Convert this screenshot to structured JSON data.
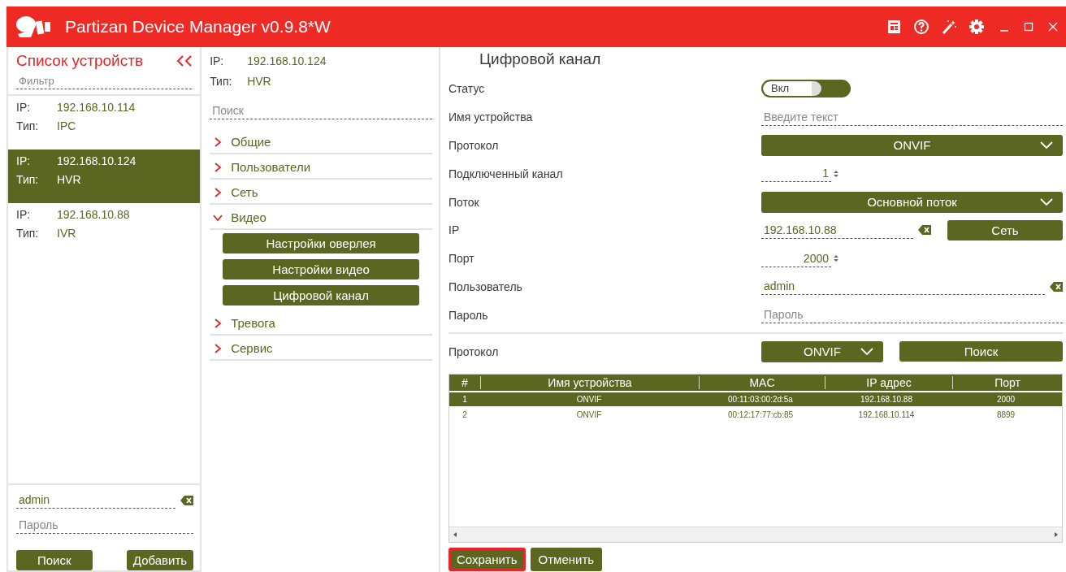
{
  "window": {
    "title": "Partizan Device Manager v0.9.8*W"
  },
  "devices_panel": {
    "title": "Список устройств",
    "filter": {
      "placeholder": "Фильтр"
    },
    "devices": [
      {
        "ip_label": "IP:",
        "ip": "192.168.10.114",
        "type_label": "Тип:",
        "type": "IPC",
        "selected": false
      },
      {
        "ip_label": "IP:",
        "ip": "192.168.10.124",
        "type_label": "Тип:",
        "type": "HVR",
        "selected": true
      },
      {
        "ip_label": "IP:",
        "ip": "192.168.10.88",
        "type_label": "Тип:",
        "type": "IVR",
        "selected": false
      }
    ],
    "login": {
      "user": "admin",
      "password_placeholder": "Пароль"
    },
    "buttons": [
      "Поиск",
      "Добавить"
    ]
  },
  "device_info": {
    "ip_label": "IP:",
    "ip": "192.168.10.124",
    "type_label": "Тип:",
    "type": "HVR"
  },
  "menu_search": {
    "placeholder": "Поиск"
  },
  "menu": [
    {
      "label": "Общие",
      "expanded": false
    },
    {
      "label": "Пользователи",
      "expanded": false
    },
    {
      "label": "Сеть",
      "expanded": false
    },
    {
      "label": "Видео",
      "expanded": true,
      "children": [
        "Настройки оверлея",
        "Настройки видео",
        "Цифровой канал"
      ]
    },
    {
      "label": "Тревога",
      "expanded": false
    },
    {
      "label": "Сервис",
      "expanded": false
    }
  ],
  "channel": {
    "title": "Цифровой канал",
    "fields": [
      {
        "kind": "toggle",
        "label": "Статус",
        "text": "Вкл",
        "on": true
      },
      {
        "kind": "text",
        "label": "Имя устройства",
        "placeholder": "Введите текст",
        "clearable": false
      },
      {
        "kind": "select",
        "label": "Протокол",
        "value": "ONVIF"
      },
      {
        "kind": "spin",
        "label": "Подключенный канал",
        "value": "1"
      },
      {
        "kind": "select",
        "label": "Поток",
        "value": "Основной поток"
      },
      {
        "kind": "text",
        "label": "IP",
        "value": "192.168.10.88",
        "clearable": true,
        "button": "Сеть"
      },
      {
        "kind": "spin",
        "label": "Порт",
        "value": "2000"
      },
      {
        "kind": "text",
        "label": "Пользователь",
        "value": "admin",
        "clearable": true
      },
      {
        "kind": "text",
        "label": "Пароль",
        "placeholder": "Пароль",
        "clearable": false
      }
    ]
  },
  "discovery": {
    "label": "Протокол",
    "protocol": "ONVIF",
    "button": "Поиск",
    "table": {
      "columns": [
        "#",
        "Имя устройства",
        "MAC",
        "IP адрес",
        "Порт"
      ],
      "rows": [
        {
          "cells": [
            "1",
            "ONVIF",
            "00:11:03:00:2d:5a",
            "192.168.10.88",
            "2000"
          ],
          "selected": true
        },
        {
          "cells": [
            "2",
            "ONVIF",
            "00:12:17:77:cb:85",
            "192.168.10.114",
            "8899"
          ],
          "selected": false
        }
      ]
    }
  },
  "actions": [
    {
      "label": "Сохранить",
      "highlighted": true
    },
    {
      "label": "Отменить",
      "highlighted": false
    }
  ]
}
